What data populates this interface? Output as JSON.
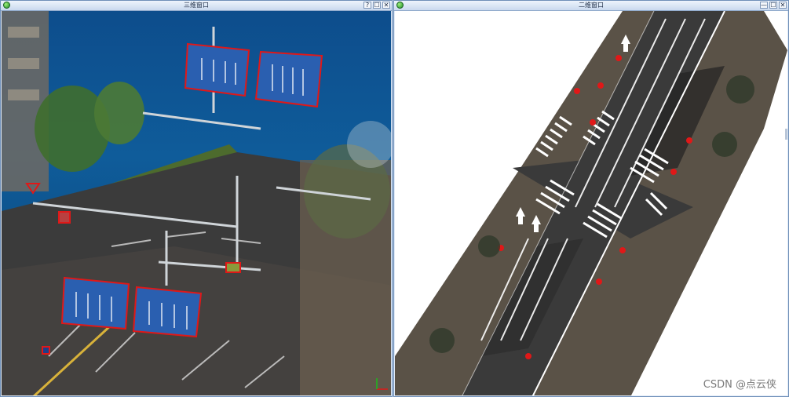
{
  "left_window": {
    "title": "三维窗口",
    "controls": {
      "help": "?",
      "maximize": "☐",
      "close": "✕"
    }
  },
  "right_window": {
    "title": "二维窗口",
    "controls": {
      "minimize": "—",
      "maximize": "☐",
      "close": "✕"
    }
  },
  "watermark": "CSDN @点云侠",
  "colors": {
    "sky": "#0f5c9a",
    "road": "#3b3b3b",
    "sign_fill": "#2a5fb0",
    "highlight": "#e01818",
    "vegetation": "#3f6e2e"
  }
}
